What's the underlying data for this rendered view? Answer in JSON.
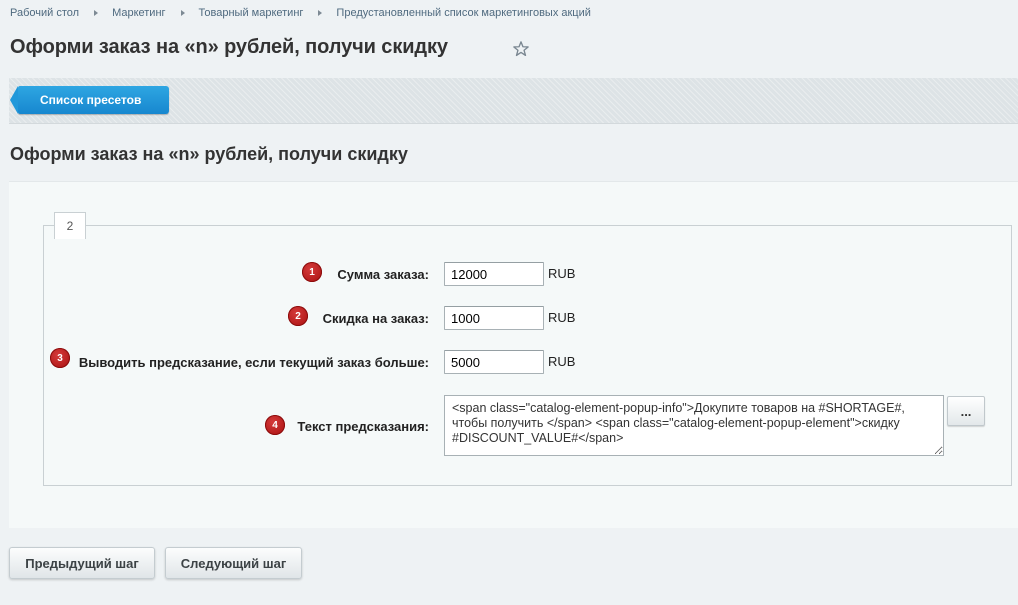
{
  "breadcrumb": [
    "Рабочий стол",
    "Маркетинг",
    "Товарный маркетинг",
    "Предустановленный список маркетинговых акций"
  ],
  "page_title": "Оформи заказ на «n» рублей, получи скидку",
  "toolbar": {
    "preset_list_label": "Список пресетов"
  },
  "section_title": "Оформи заказ на «n» рублей, получи скидку",
  "step": "2",
  "form": {
    "order_sum": {
      "badge": "1",
      "label": "Сумма заказа:",
      "value": "12000",
      "unit": "RUB"
    },
    "discount": {
      "badge": "2",
      "label": "Скидка на заказ:",
      "value": "1000",
      "unit": "RUB"
    },
    "show_hint": {
      "badge": "3",
      "label": "Выводить предсказание, если текущий заказ больше:",
      "value": "5000",
      "unit": "RUB"
    },
    "hint_text": {
      "badge": "4",
      "label": "Текст предсказания:",
      "value": "<span class=\"catalog-element-popup-info\">Докупите товаров на #SHORTAGE#, чтобы получить </span> <span class=\"catalog-element-popup-element\">скидку #DISCOUNT_VALUE#</span>",
      "button_label": "..."
    }
  },
  "footer": {
    "prev_label": "Предыдущий шаг",
    "next_label": "Следующий шаг"
  },
  "colors": {
    "accent": "#1f92d6",
    "badge": "#b81c1c",
    "page_bg": "#eef2f4"
  }
}
